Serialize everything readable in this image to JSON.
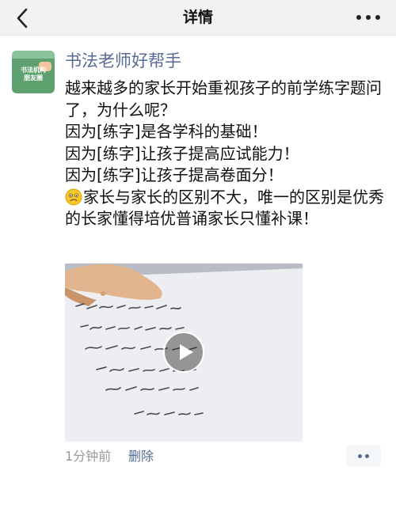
{
  "navbar": {
    "title": "详情",
    "back_icon": "chevron-left-icon",
    "more_icon": "more-dots-icon"
  },
  "post": {
    "avatar": {
      "line1": "书法机构",
      "line2": "朋友圈"
    },
    "author": "书法老师好帮手",
    "lines": [
      "越来越多的家长开始重视孩子的前学练字题问了，为什么呢？",
      "因为[练字]是各学科的基础！",
      "因为[练字]让孩子提高应试能力！",
      "因为[练字]让孩子提高卷面分！"
    ],
    "emoji_icon": "worried-face-emoji",
    "last_line": "家长与家长的区别不大，唯一的区别是优秀的长家懂得培优普诵家长只懂补课！",
    "video": {
      "play_icon": "play-icon"
    },
    "timestamp": "1分钟前",
    "delete_label": "删除",
    "comment_icon": "comment-dots-icon"
  },
  "colors": {
    "link": "#576b95",
    "meta": "#999999",
    "navbar_bg": "#f2f2f2"
  }
}
